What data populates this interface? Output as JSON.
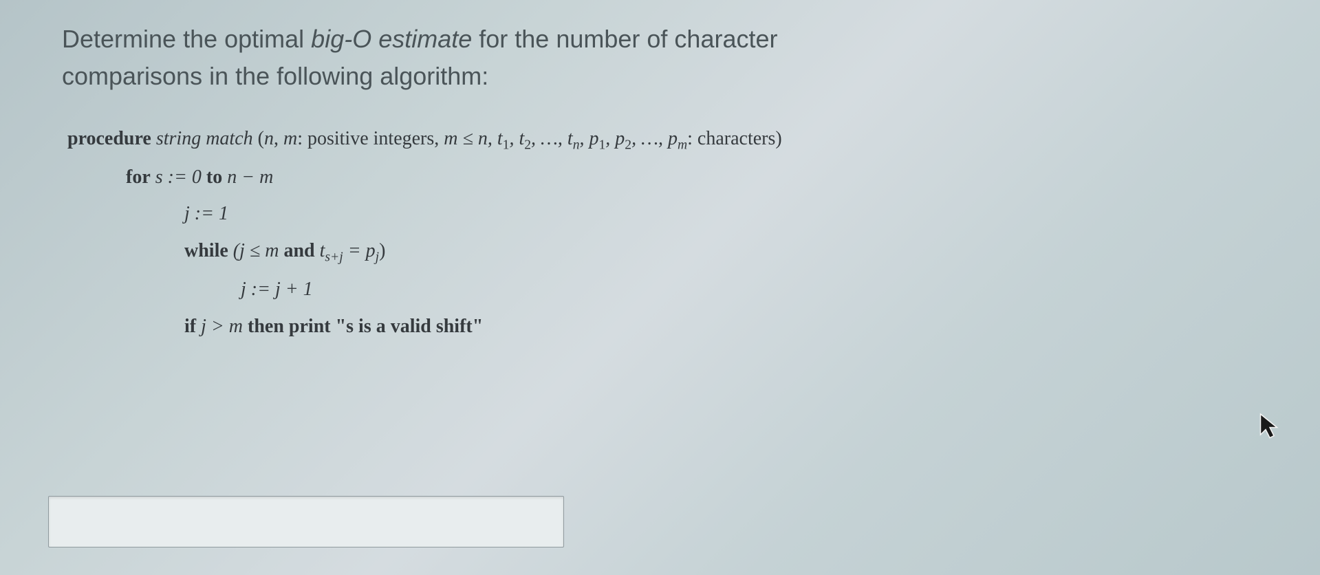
{
  "question": {
    "line1_prefix": "Determine the optimal ",
    "line1_italic": "big-O estimate",
    "line1_suffix": " for the number of character",
    "line2": "comparisons in the following algorithm:"
  },
  "algorithm": {
    "proc_bold": "procedure",
    "proc_ital": " string match ",
    "proc_rest_a": "(",
    "proc_n": "n",
    "proc_rest_b": ", ",
    "proc_m": "m",
    "proc_rest_c": ": positive integers, ",
    "proc_ineq": "m ≤ n",
    "proc_seq1": ", t",
    "proc_sub1": "1",
    "proc_seq2": ", t",
    "proc_sub2": "2",
    "proc_seq3": ", …, t",
    "proc_subn": "n",
    "proc_seq4": ", p",
    "proc_subp1": "1",
    "proc_seq5": ", p",
    "proc_subp2": "2",
    "proc_seq6": ", …, p",
    "proc_subpm": "m",
    "proc_end": ": characters)",
    "for_bold": "for",
    "for_rest": " s := 0 ",
    "for_to": "to",
    "for_end": " n − m",
    "j1": "j := 1",
    "while_bold": "while",
    "while_rest_a": " (j ≤ m ",
    "while_and": "and",
    "while_rest_b": " t",
    "while_sub1": "s+j",
    "while_eq": " = p",
    "while_sub2": "j",
    "while_close": ")",
    "jinc": "j := j + 1",
    "if_bold": "if",
    "if_cond": " j > m ",
    "then_bold": "then print ",
    "if_msg": "\"s is a valid shift\""
  },
  "answer": {
    "value": "",
    "placeholder": ""
  }
}
